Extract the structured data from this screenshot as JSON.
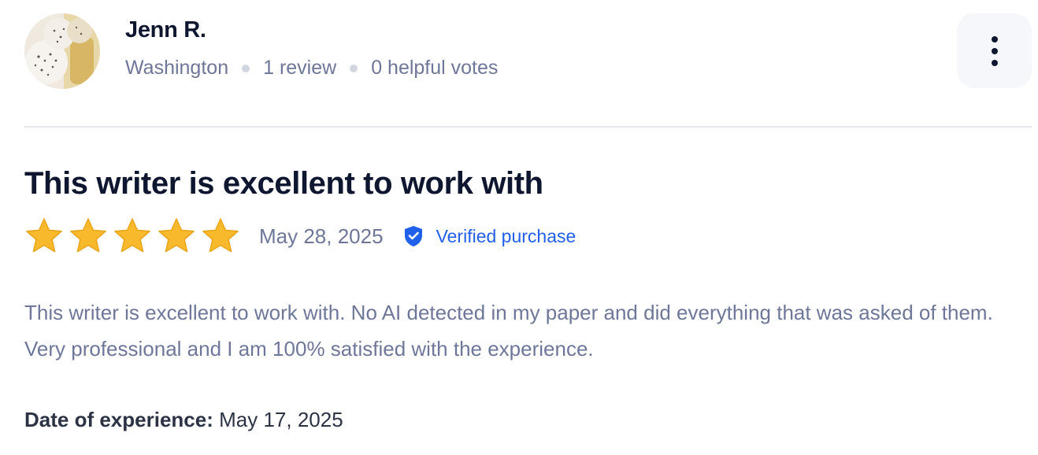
{
  "reviewer": {
    "name": "Jenn R.",
    "location": "Washington",
    "reviews": "1 review",
    "helpful_votes": "0 helpful votes",
    "avatar_icon": "avatar-photo"
  },
  "menu": {
    "icon": "more-vertical-icon"
  },
  "review": {
    "title": "This writer is excellent to work with",
    "rating": 5,
    "rating_max": 5,
    "date": "May 28, 2025",
    "verified_label": "Verified purchase",
    "verified_icon": "shield-check-icon",
    "body": "This writer is excellent to work with. No AI detected in my paper and did everything that was asked of them. Very professional and I am 100% satisfied with the experience.",
    "experience_label": "Date of experience:",
    "experience_date": "May 17, 2025"
  },
  "colors": {
    "heading": "#0f1730",
    "muted": "#6e7799",
    "verified": "#2160ea",
    "star": "#f9b92c",
    "divider": "#e6e8ee",
    "menu_bg": "#f5f7fa"
  }
}
